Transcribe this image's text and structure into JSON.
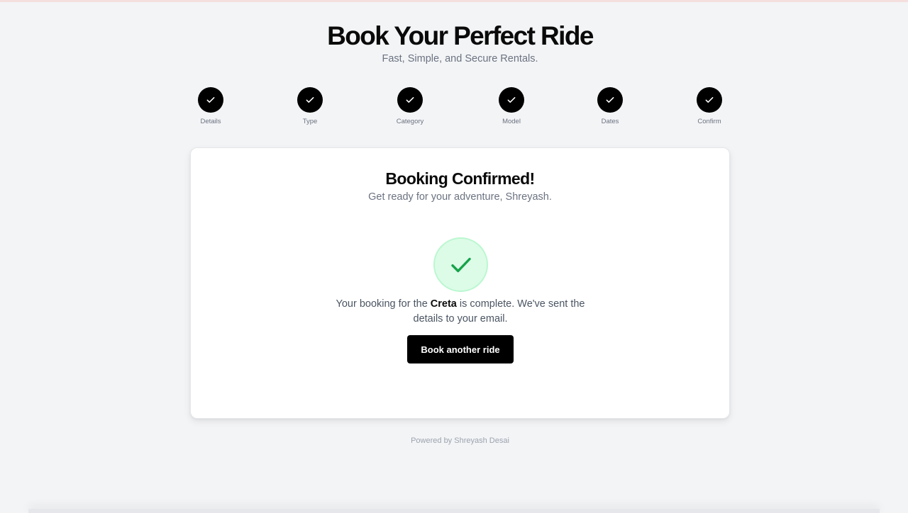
{
  "header": {
    "title": "Book Your Perfect Ride",
    "subtitle": "Fast, Simple, and Secure Rentals."
  },
  "stepper": {
    "steps": [
      {
        "label": "Details",
        "status": "complete"
      },
      {
        "label": "Type",
        "status": "complete"
      },
      {
        "label": "Category",
        "status": "complete"
      },
      {
        "label": "Model",
        "status": "complete"
      },
      {
        "label": "Dates",
        "status": "complete"
      },
      {
        "label": "Confirm",
        "status": "complete"
      }
    ]
  },
  "confirmation": {
    "title": "Booking Confirmed!",
    "subtitle": "Get ready for your adventure, Shreyash.",
    "icon": "check-circle-icon",
    "message_prefix": "Your booking for the ",
    "vehicle": "Creta",
    "message_suffix": " is complete. We've sent the details to your email.",
    "button_label": "Book another ride"
  },
  "footer": {
    "text": "Powered by Shreyash Desai"
  },
  "colors": {
    "accent": "#000000",
    "success": "#16a34a",
    "success_bg": "#dcfce7",
    "background": "#f3f4f6"
  }
}
